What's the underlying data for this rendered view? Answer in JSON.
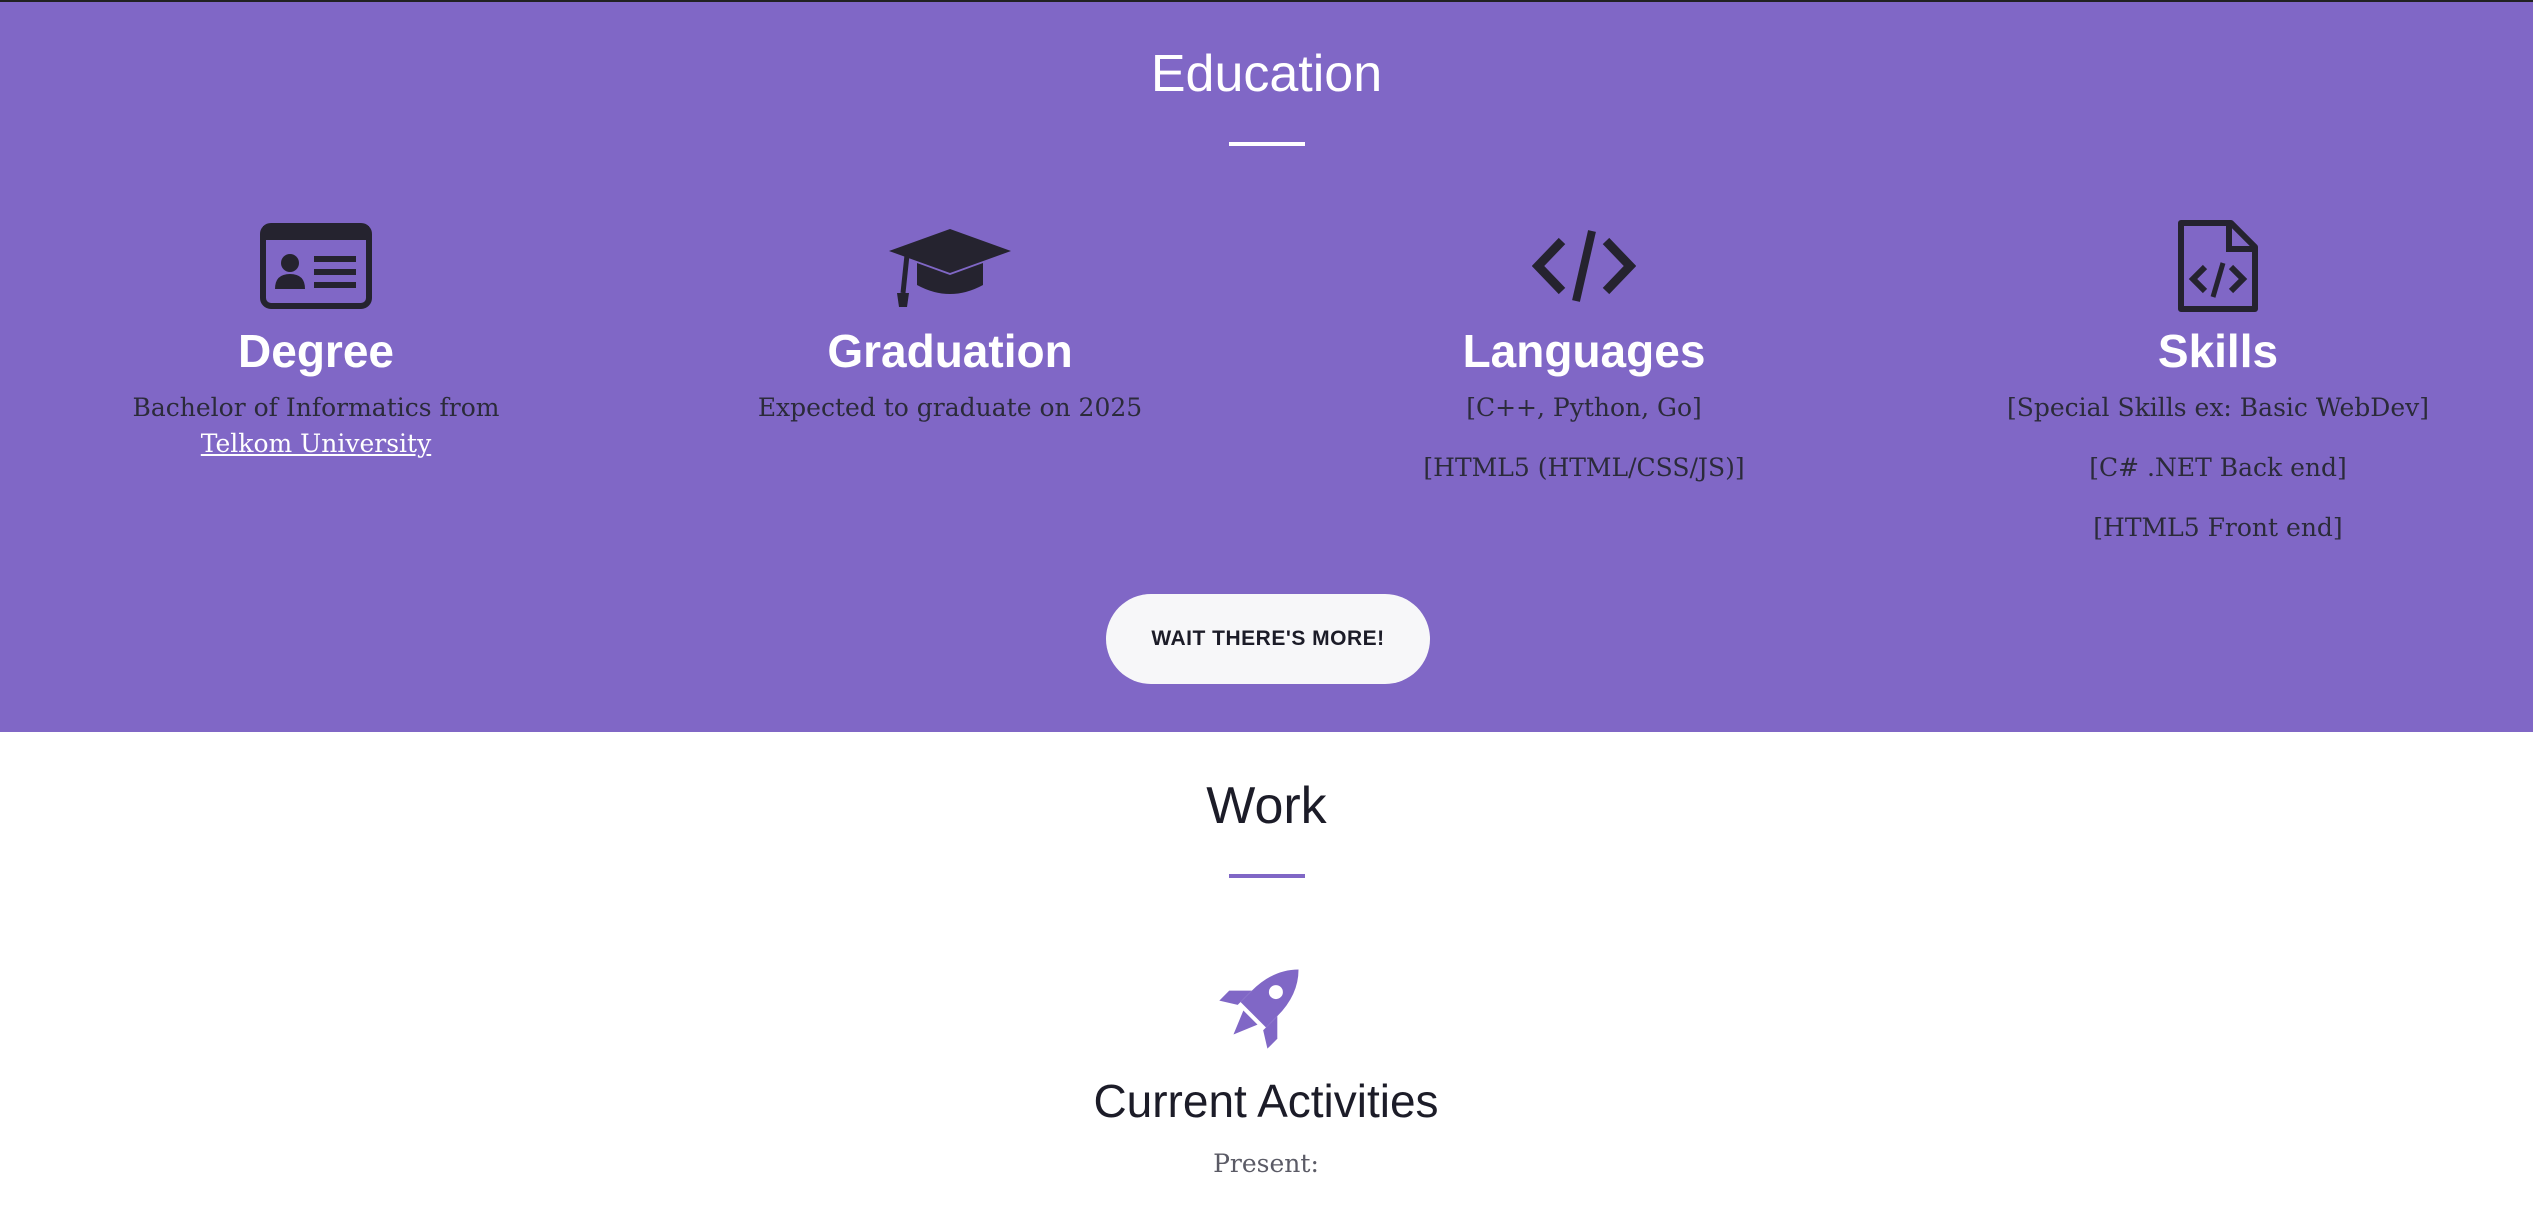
{
  "education": {
    "title": "Education",
    "columns": [
      {
        "icon": "id-card-icon",
        "heading": "Degree",
        "text": "Bachelor of Informatics from",
        "link": "Telkom University"
      },
      {
        "icon": "graduation-cap-icon",
        "heading": "Graduation",
        "text": "Expected to graduate on 2025"
      },
      {
        "icon": "code-icon",
        "heading": "Languages",
        "items": [
          "[C++, Python, Go]",
          "[HTML5 (HTML/CSS/JS)]"
        ]
      },
      {
        "icon": "code-file-icon",
        "heading": "Skills",
        "items": [
          "[Special Skills ex: Basic WebDev]",
          "[C# .NET Back end]",
          "[HTML5 Front end]"
        ]
      }
    ],
    "more_button": "WAIT THERE'S MORE!"
  },
  "work": {
    "title": "Work",
    "item": {
      "icon": "rocket-icon",
      "heading": "Current Activities",
      "text": "Present:"
    }
  },
  "colors": {
    "accent": "#8067c6",
    "icon_dark": "#25232f",
    "text_dark": "#1c1c28"
  }
}
